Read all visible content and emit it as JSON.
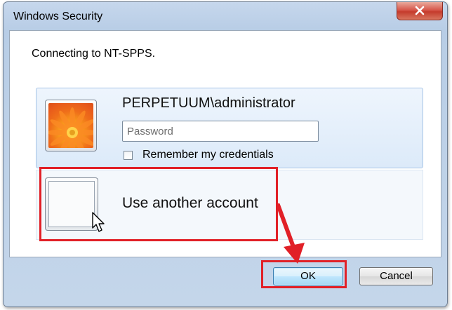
{
  "window": {
    "title": "Windows Security"
  },
  "dialog": {
    "message": "Connecting to NT-SPPS.",
    "current_user": {
      "name": "PERPETUUM\\administrator",
      "password_placeholder": "Password",
      "password_value": "",
      "remember_label": "Remember my credentials",
      "remember_checked": false
    },
    "other_account": {
      "label": "Use another account"
    }
  },
  "buttons": {
    "ok": "OK",
    "cancel": "Cancel"
  },
  "colors": {
    "highlight": "#e12027",
    "accent": "#3c7fb1"
  },
  "icons": [
    "close-icon",
    "user-avatar-flower",
    "blank-avatar",
    "mouse-cursor-icon",
    "arrow-icon"
  ]
}
